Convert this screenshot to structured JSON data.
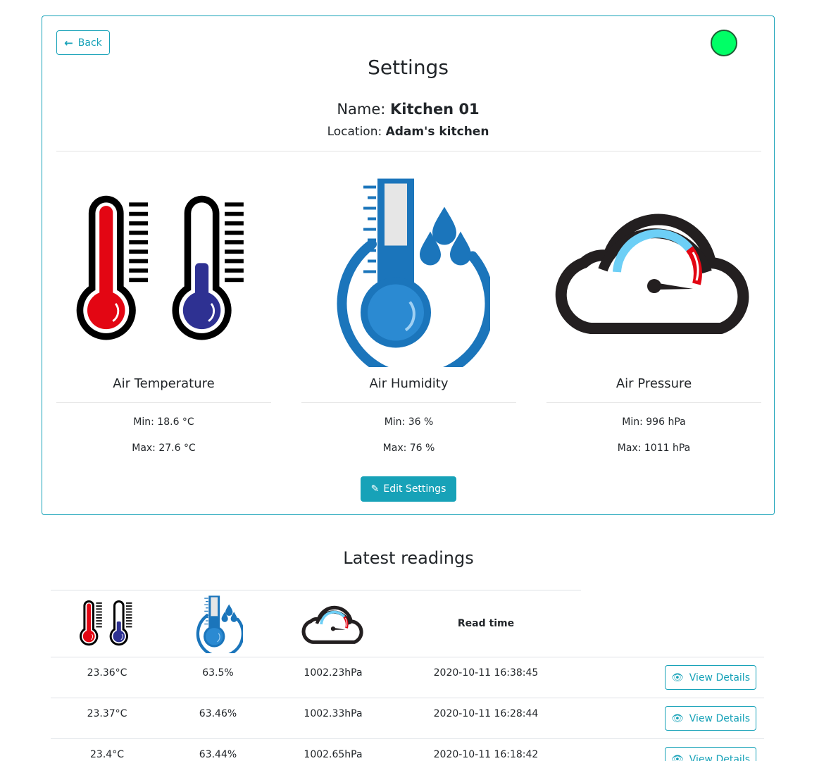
{
  "header": {
    "back_label": "Back",
    "title": "Settings",
    "status_color": "#00ff66"
  },
  "device": {
    "name_label": "Name:",
    "name": "Kitchen 01",
    "location_label": "Location:",
    "location": "Adam's kitchen"
  },
  "sensors": [
    {
      "icon": "thermometer-pair-icon",
      "title": "Air Temperature",
      "min": "Min: 18.6 °C",
      "max": "Max: 27.6 °C"
    },
    {
      "icon": "humidity-thermometer-icon",
      "title": "Air Humidity",
      "min": "Min: 36 %",
      "max": "Max: 76 %"
    },
    {
      "icon": "cloud-gauge-icon",
      "title": "Air Pressure",
      "min": "Min: 996 hPa",
      "max": "Max: 1011 hPa"
    }
  ],
  "edit_label": "Edit Settings",
  "latest": {
    "title": "Latest readings",
    "read_time_header": "Read time",
    "view_label": "View Details",
    "rows": [
      {
        "temp": "23.36°C",
        "humidity": "63.5%",
        "pressure": "1002.23hPa",
        "time": "2020-10-11 16:38:45"
      },
      {
        "temp": "23.37°C",
        "humidity": "63.46%",
        "pressure": "1002.33hPa",
        "time": "2020-10-11 16:28:44"
      },
      {
        "temp": "23.4°C",
        "humidity": "63.44%",
        "pressure": "1002.65hPa",
        "time": "2020-10-11 16:18:42"
      }
    ]
  },
  "colors": {
    "accent": "#17a2b8",
    "hot": "#e30613",
    "cold": "#2e3192",
    "water": "#1b75bb",
    "gauge_light": "#6dcff6"
  }
}
